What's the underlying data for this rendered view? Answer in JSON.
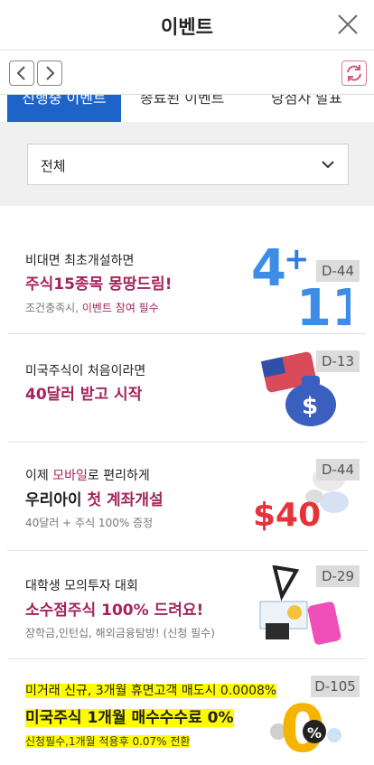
{
  "header": {
    "title": "이벤트"
  },
  "tabs": [
    "진행중 이벤트",
    "종료된 이벤트",
    "당첨자 발표"
  ],
  "filter": {
    "selected": "전체"
  },
  "events": [
    {
      "sub": "비대면 최초개설하면",
      "main": "주식15종목 몽땅드림!",
      "note_prefix": "조건충족시,",
      "note_highlight": "이벤트 참여 필수",
      "dday": "D-44"
    },
    {
      "sub": "미국주식이 처음이라면",
      "main": "40달러 받고 시작",
      "dday": "D-13"
    },
    {
      "sub_prefix": "이제",
      "sub_highlight": "모바일",
      "sub_suffix": "로 편리하게",
      "main_prefix": "우리아이",
      "main_highlight": "첫 계좌개설",
      "note": "40달러 + 주식 100% 증정",
      "dday": "D-44",
      "art_text": "$40"
    },
    {
      "sub": "대학생 모의투자 대회",
      "main": "소수점주식 100% 드려요!",
      "note": "장학금,인턴십, 해외금융탐방! (신청 필수)",
      "dday": "D-29"
    },
    {
      "sub": "미거래 신규, 3개월 휴면고객 매도시 0.0008%",
      "main": "미국주식 1개월 매수수수료 0%",
      "note": "신청필수,1개월 적용후 0.07% 전환",
      "dday": "D-105",
      "art_text": "0",
      "art_sub": "%"
    }
  ],
  "colors": {
    "accent": "#a3245c",
    "tab_active": "#1e64c8",
    "highlight": "#fffc00"
  },
  "icons": [
    "close-icon",
    "back-icon",
    "forward-icon",
    "refresh-icon",
    "chevron-down-icon"
  ]
}
